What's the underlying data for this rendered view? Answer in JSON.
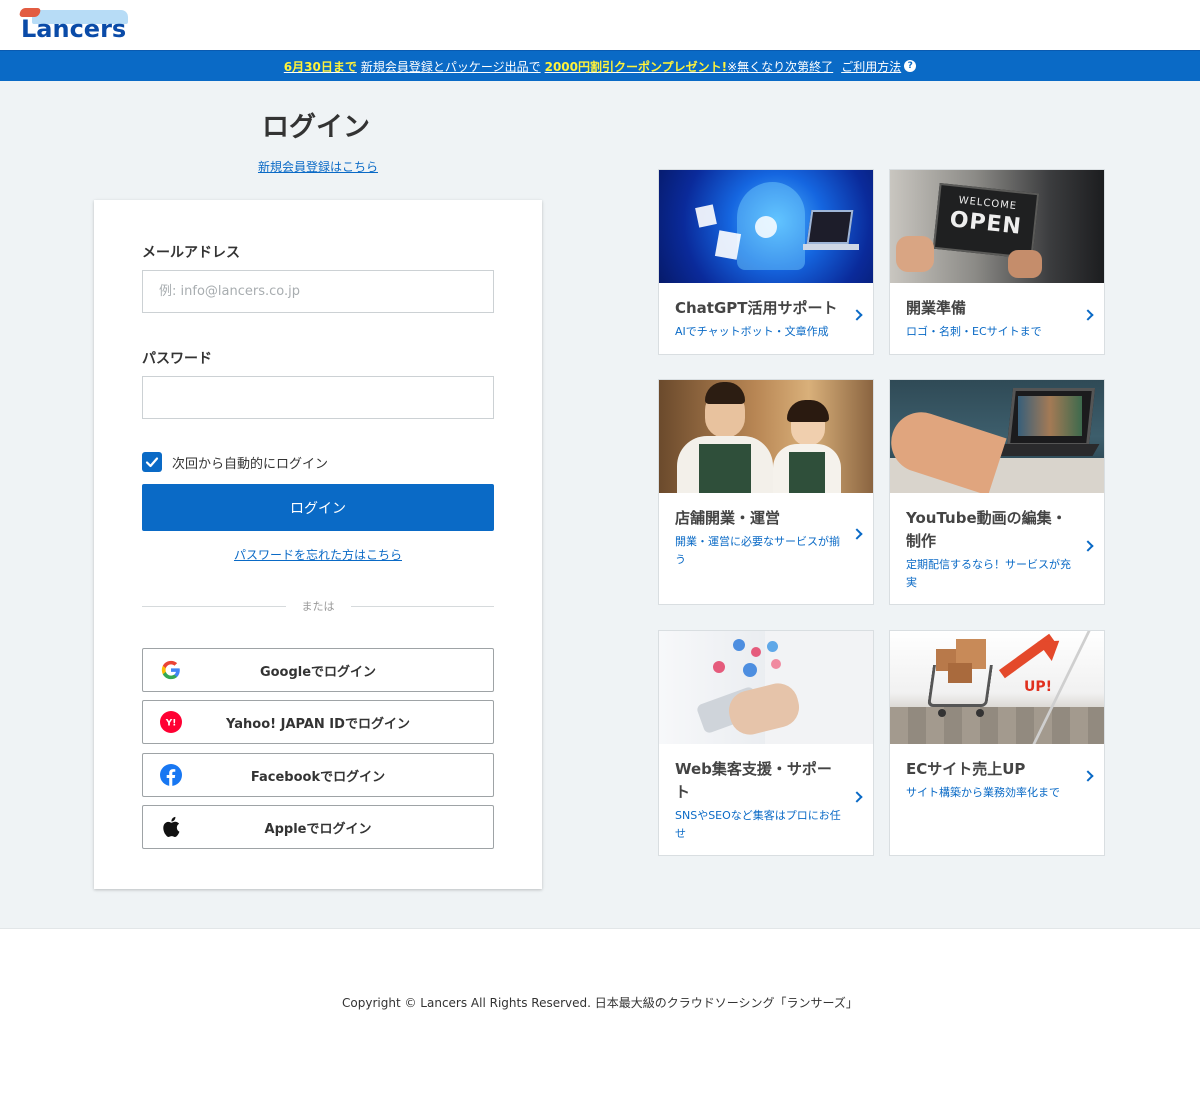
{
  "brand": {
    "logo_text": "Lancers"
  },
  "banner": {
    "deadline": "6月30日まで",
    "campaign": "新規会員登録とパッケージ出品で",
    "coupon": "2000円割引クーポンプレゼント!",
    "note": "※無くなり次第終了",
    "howto": "ご利用方法",
    "help_icon": "question-icon"
  },
  "login": {
    "title": "ログイン",
    "signup_link": "新規会員登録はこちら",
    "email_label": "メールアドレス",
    "email_placeholder": "例: info@lancers.co.jp",
    "email_value": "",
    "password_label": "パスワード",
    "password_value": "",
    "remember_label": "次回から自動的にログイン",
    "remember_checked": true,
    "submit_label": "ログイン",
    "forgot_link": "パスワードを忘れた方はこちら",
    "divider_text": "または",
    "social": [
      {
        "label": "Googleでログイン",
        "icon": "google-icon"
      },
      {
        "label": "Yahoo! JAPAN IDでログイン",
        "icon": "yahoo-icon"
      },
      {
        "label": "Facebookでログイン",
        "icon": "facebook-icon"
      },
      {
        "label": "Appleでログイン",
        "icon": "apple-icon"
      }
    ]
  },
  "promos": [
    {
      "title": "ChatGPT活用サポート",
      "subtitle": "AIでチャットボット・文章作成"
    },
    {
      "title": "開業準備",
      "subtitle": "ロゴ・名刺・ECサイトまで",
      "image_text_top": "WELCOME",
      "image_text_main": "OPEN"
    },
    {
      "title": "店舗開業・運営",
      "subtitle": "開業・運営に必要なサービスが揃う"
    },
    {
      "title": "YouTube動画の編集・制作",
      "subtitle": "定期配信するなら！サービスが充実"
    },
    {
      "title": "Web集客支援・サポート",
      "subtitle": "SNSやSEOなど集客はプロにお任せ"
    },
    {
      "title": "ECサイト売上UP",
      "subtitle": "サイト構築から業務効率化まで",
      "image_text": "UP!"
    }
  ],
  "footer": {
    "copyright": "Copyright © Lancers All Rights Reserved. 日本最大級のクラウドソーシング「ランサーズ」"
  },
  "colors": {
    "primary": "#0a6ac6",
    "banner_highlight": "#fff23a",
    "background": "#eff3f5"
  }
}
